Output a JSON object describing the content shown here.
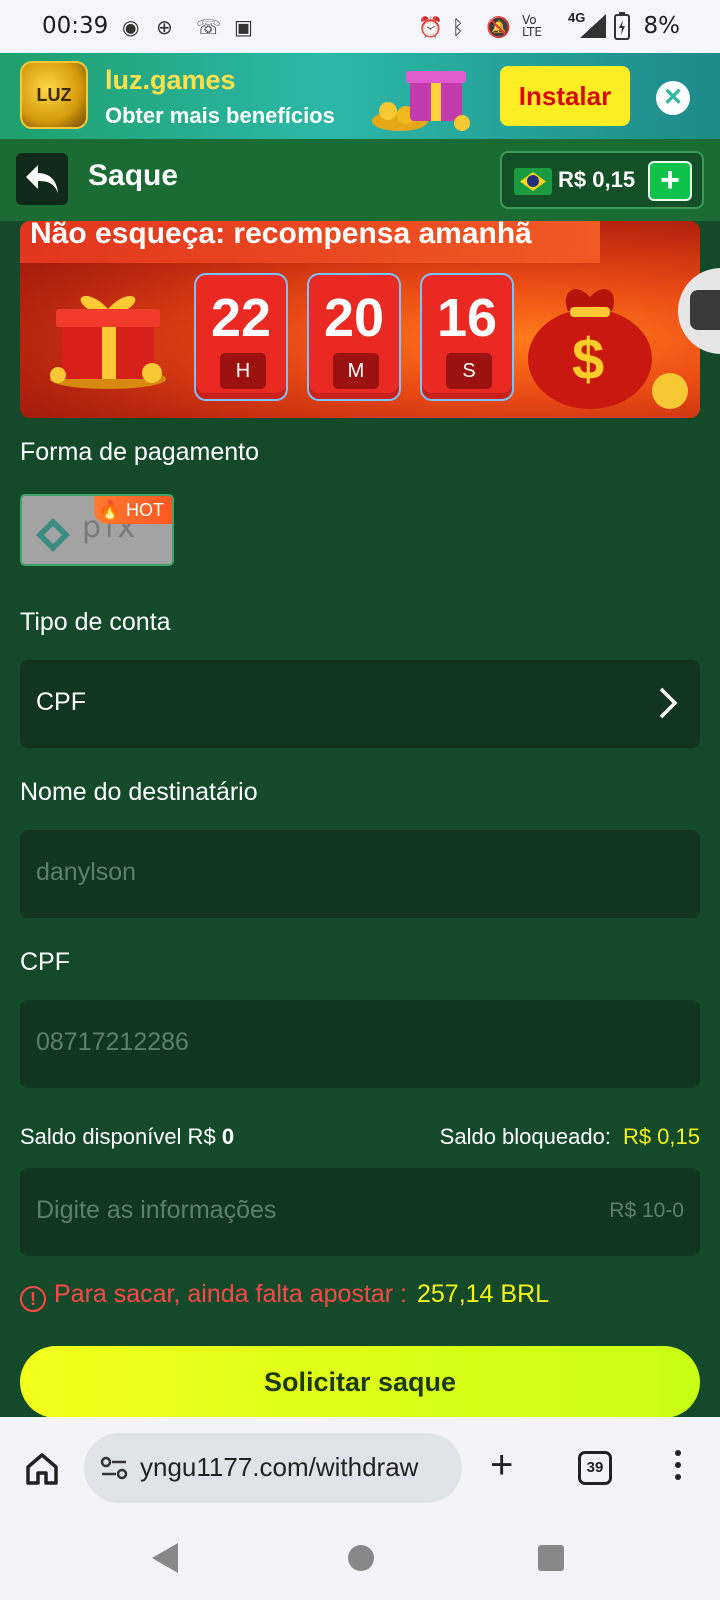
{
  "status_bar": {
    "time": "00:39",
    "network_label": "4G",
    "battery": "8%"
  },
  "promo": {
    "logo_text": "LUZ",
    "title": "luz.games",
    "subtitle": "Obter mais benefícios",
    "install_label": "Instalar",
    "close_symbol": "✕"
  },
  "header": {
    "title": "Saque",
    "balance": "R$ 0,15",
    "plus_symbol": "+"
  },
  "reward": {
    "title": "Não esqueça: recompensa amanhã",
    "countdown": [
      {
        "value": "22",
        "unit": "H"
      },
      {
        "value": "20",
        "unit": "M"
      },
      {
        "value": "16",
        "unit": "S"
      }
    ]
  },
  "payment": {
    "label": "Forma de pagamento",
    "method_name": "pix",
    "hot_badge": "HOT"
  },
  "account_type": {
    "label": "Tipo de conta",
    "value": "CPF"
  },
  "recipient": {
    "label": "Nome do destinatário",
    "value": "danylson"
  },
  "cpf": {
    "label": "CPF",
    "value": "08717212286"
  },
  "balance": {
    "available_label": "Saldo disponível R$",
    "available_value": "0",
    "blocked_label": "Saldo bloqueado:",
    "blocked_value": "R$ 0,15"
  },
  "amount_input": {
    "placeholder": "Digite as informações",
    "range_hint": "R$ 10-0"
  },
  "warning": {
    "icon": "!",
    "text": "Para sacar, ainda falta apostar :",
    "amount": "257,14 BRL"
  },
  "submit_label": "Solicitar saque",
  "browser": {
    "url": "yngu1177.com/withdraw",
    "tabs_count": "39",
    "new_tab_symbol": "+"
  },
  "colors": {
    "background": "#144a2a",
    "header": "#1a6b34",
    "field": "#11351f",
    "accent_yellow": "#f2f21b",
    "warning_red": "#ff4848"
  }
}
